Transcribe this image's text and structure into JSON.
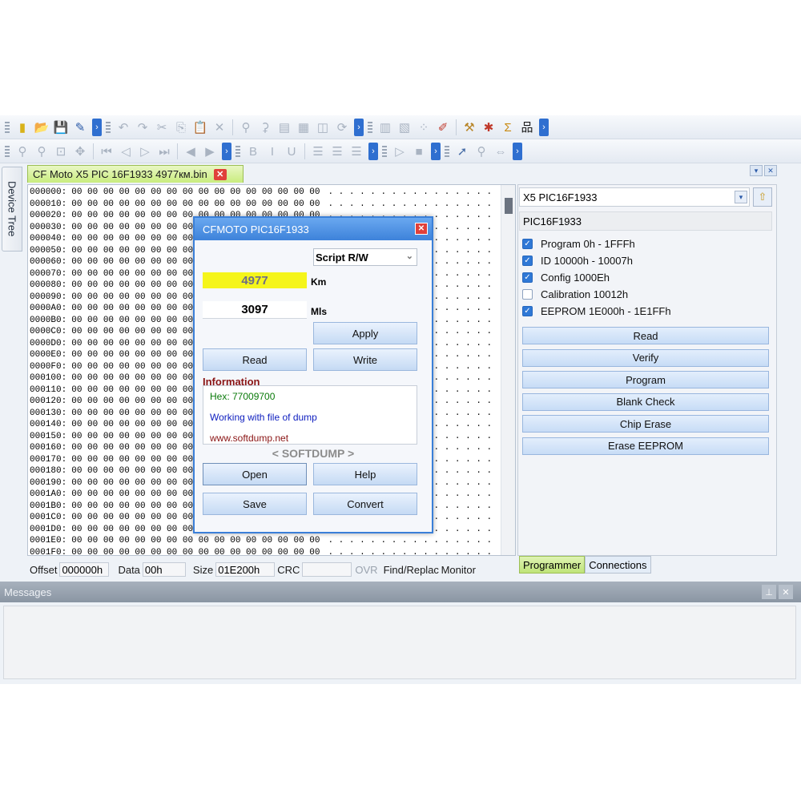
{
  "editor": {
    "device_tree_label": "Device Tree",
    "tab_title": "CF Moto X5 PIC 16F1933  4977км.bin",
    "hex_rows": [
      {
        "addr": "000000:",
        "hex": "00 00 00 00 00 00 00 00 00 00 00 00 00 00 00 00",
        "ascii": ". . . . . . . . . . . . . . . ."
      },
      {
        "addr": "000010:",
        "hex": "00 00 00 00 00 00 00 00 00 00 00 00 00 00 00 00",
        "ascii": ". . . . . . . . . . . . . . . ."
      },
      {
        "addr": "000020:",
        "hex": "00 00 00 00 00 00 00 00 00 00 00 00 00 00 00 00",
        "ascii": ". . . . . . . . . . . . . . . ."
      },
      {
        "addr": "000030:",
        "hex": "00 00 00 00 00 00 00 00 00 00 00 00 00 00 00 00",
        "ascii": ". . . . . . . . . . . . . . . ."
      },
      {
        "addr": "000040:",
        "hex": "00 00 00 00 00 00 00 00 00 00 00 00 00 00 00 00",
        "ascii": ". . . . . . . . . . . . . . . ."
      },
      {
        "addr": "000050:",
        "hex": "00 00 00 00 00 00 00 00 00 00 00 00 00 00 00 00",
        "ascii": ". . . . . . . . . . . . . . . ."
      },
      {
        "addr": "000060:",
        "hex": "00 00 00 00 00 00 00 00 00 00 00 00 00 00 00 00",
        "ascii": ". . . . . . . . . . . . . . . ."
      },
      {
        "addr": "000070:",
        "hex": "00 00 00 00 00 00 00 00 00 00 00 00 00 00 00 00",
        "ascii": ". . . . . . . . . . . . . . . ."
      },
      {
        "addr": "000080:",
        "hex": "00 00 00 00 00 00 00 00 00 00 00 00 00 00 00 00",
        "ascii": ". . . . . . . . . . . . . . . ."
      },
      {
        "addr": "000090:",
        "hex": "00 00 00 00 00 00 00 00 00 00 00 00 00 00 00 00",
        "ascii": ". . . . . . . . . . . . . . . ."
      },
      {
        "addr": "0000A0:",
        "hex": "00 00 00 00 00 00 00 00 00 00 00 00 00 00 00 00",
        "ascii": ". . . . . . . . . . . . . . . ."
      },
      {
        "addr": "0000B0:",
        "hex": "00 00 00 00 00 00 00 00 00 00 00 00 00 00 00 00",
        "ascii": ". . . . . . . . . . . . . . . ."
      },
      {
        "addr": "0000C0:",
        "hex": "00 00 00 00 00 00 00 00 00 00 00 00 00 00 00 00",
        "ascii": ". . . . . . . . . . . . . . . ."
      },
      {
        "addr": "0000D0:",
        "hex": "00 00 00 00 00 00 00 00 00 00 00 00 00 00 00 00",
        "ascii": ". . . . . . . . . . . . . . . ."
      },
      {
        "addr": "0000E0:",
        "hex": "00 00 00 00 00 00 00 00 00 00 00 00 00 00 00 00",
        "ascii": ". . . . . . . . . . . . . . . ."
      },
      {
        "addr": "0000F0:",
        "hex": "00 00 00 00 00 00 00 00 00 00 00 00 00 00 00 00",
        "ascii": ". . . . . . . . . . . . . . . ."
      },
      {
        "addr": "000100:",
        "hex": "00 00 00 00 00 00 00 00 00 00 00 00 00 00 00 00",
        "ascii": ". . . . . . . . . . . . . . . ."
      },
      {
        "addr": "000110:",
        "hex": "00 00 00 00 00 00 00 00 00 00 00 00 00 00 00 00",
        "ascii": ". . . . . . . . . . . . . . . ."
      },
      {
        "addr": "000120:",
        "hex": "00 00 00 00 00 00 00 00 00 00 00 00 00 00 00 00",
        "ascii": ". . . . . . . . . . . . . . . ."
      },
      {
        "addr": "000130:",
        "hex": "00 00 00 00 00 00 00 00 00 00 00 00 00 00 00 00",
        "ascii": ". . . . . . . . . . . . . . . ."
      },
      {
        "addr": "000140:",
        "hex": "00 00 00 00 00 00 00 00 00 00 00 00 00 00 00 00",
        "ascii": ". . . . . . . . . . . . . . . ."
      },
      {
        "addr": "000150:",
        "hex": "00 00 00 00 00 00 00 00 00 00 00 00 00 00 00 00",
        "ascii": ". . . . . . . . . . . . . . . ."
      },
      {
        "addr": "000160:",
        "hex": "00 00 00 00 00 00 00 00 00 00 00 00 00 00 00 00",
        "ascii": ". . . . . . . . . . . . . . . ."
      },
      {
        "addr": "000170:",
        "hex": "00 00 00 00 00 00 00 00 00 00 00 00 00 00 00 00",
        "ascii": ". . . . . . . . . . . . . . . ."
      },
      {
        "addr": "000180:",
        "hex": "00 00 00 00 00 00 00 00 00 00 00 00 00 00 00 00",
        "ascii": ". . . . . . . . . . . . . . . ."
      },
      {
        "addr": "000190:",
        "hex": "00 00 00 00 00 00 00 00 00 00 00 00 00 00 00 00",
        "ascii": ". . . . . . . . . . . . . . . ."
      },
      {
        "addr": "0001A0:",
        "hex": "00 00 00 00 00 00 00 00 00 00 00 00 00 00 00 00",
        "ascii": ". . . . . . . . . . . . . . . ."
      },
      {
        "addr": "0001B0:",
        "hex": "00 00 00 00 00 00 00 00 00 00 00 00 00 00 00 00",
        "ascii": ". . . . . . . . . . . . . . . ."
      },
      {
        "addr": "0001C0:",
        "hex": "00 00 00 00 00 00 00 00 00 00 00 00 00 00 00 00",
        "ascii": ". . . . . . . . . . . . . . . ."
      },
      {
        "addr": "0001D0:",
        "hex": "00 00 00 00 00 00 00 00 00 00 00 00 00 00 00 00",
        "ascii": ". . . . . . . . . . . . . . . ."
      },
      {
        "addr": "0001E0:",
        "hex": "00 00 00 00 00 00 00 00 00 00 00 00 00 00 00 00",
        "ascii": ". . . . . . . . . . . . . . . ."
      },
      {
        "addr": "0001F0:",
        "hex": "00 00 00 00 00 00 00 00 00 00 00 00 00 00 00 00",
        "ascii": ". . . . . . . . . . . . . . . ."
      }
    ]
  },
  "status": {
    "offset_label": "Offset",
    "offset_value": "000000h",
    "data_label": "Data",
    "data_value": "00h",
    "size_label": "Size",
    "size_value": "01E200h",
    "crc_label": "CRC",
    "crc_value": "",
    "ovr_label": "OVR",
    "find_label": "Find/Replace",
    "monitor_label": "Monitor"
  },
  "programmer": {
    "device_select": "X5 PIC16F1933",
    "chip_name": "PIC16F1933",
    "regions": [
      {
        "label": "Program 0h - 1FFFh",
        "checked": true
      },
      {
        "label": "ID 10000h - 10007h",
        "checked": true
      },
      {
        "label": "Config 1000Eh",
        "checked": true
      },
      {
        "label": "Calibration 10012h",
        "checked": false
      },
      {
        "label": "EEPROM 1E000h - 1E1FFh",
        "checked": true
      }
    ],
    "buttons": [
      "Read",
      "Verify",
      "Program",
      "Blank Check",
      "Chip Erase",
      "Erase EEPROM"
    ],
    "tab_programmer": "Programmer",
    "tab_connections": "Connections"
  },
  "messages": {
    "title": "Messages"
  },
  "dialog": {
    "title": "CFMOTO PIC16F1933",
    "script_mode": "Script R/W",
    "km_value": "4977",
    "km_unit": "Km",
    "mls_value": "3097",
    "mls_unit": "Mls",
    "apply_label": "Apply",
    "read_label": "Read",
    "write_label": "Write",
    "info_label": "Information",
    "info_hex": "Hex: 77009700",
    "info_working": "Working with file of dump",
    "info_site": "www.softdump.net",
    "brand": "< SOFTDUMP >",
    "open_label": "Open",
    "help_label": "Help",
    "save_label": "Save",
    "convert_label": "Convert"
  },
  "colors": {
    "accent": "#3d82da",
    "km_highlight": "#f5f51a",
    "info_hex_color": "#0a7a0a",
    "info_working_color": "#1020c0",
    "info_site_color": "#8a1414"
  }
}
